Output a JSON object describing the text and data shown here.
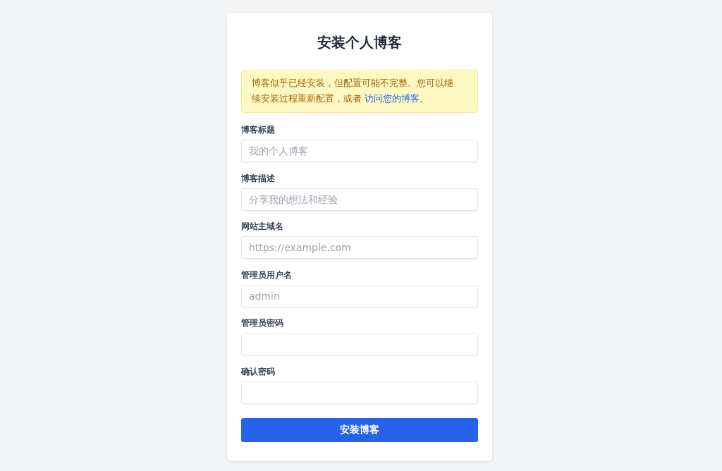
{
  "title": "安装个人博客",
  "alert": {
    "text": "博客似乎已经安装，但配置可能不完整。您可以继续安装过程重新配置，或者",
    "link": "访问您的博客",
    "after_link": "。"
  },
  "fields": [
    {
      "label": "博客标题",
      "placeholder": "我的个人博客"
    },
    {
      "label": "博客描述",
      "placeholder": "分享我的想法和经验"
    },
    {
      "label": "网站主域名",
      "placeholder": "https://example.com"
    },
    {
      "label": "管理员用户名",
      "placeholder": "admin"
    },
    {
      "label": "管理员密码"
    },
    {
      "label": "确认密码"
    }
  ],
  "submit_button": "安装博客"
}
